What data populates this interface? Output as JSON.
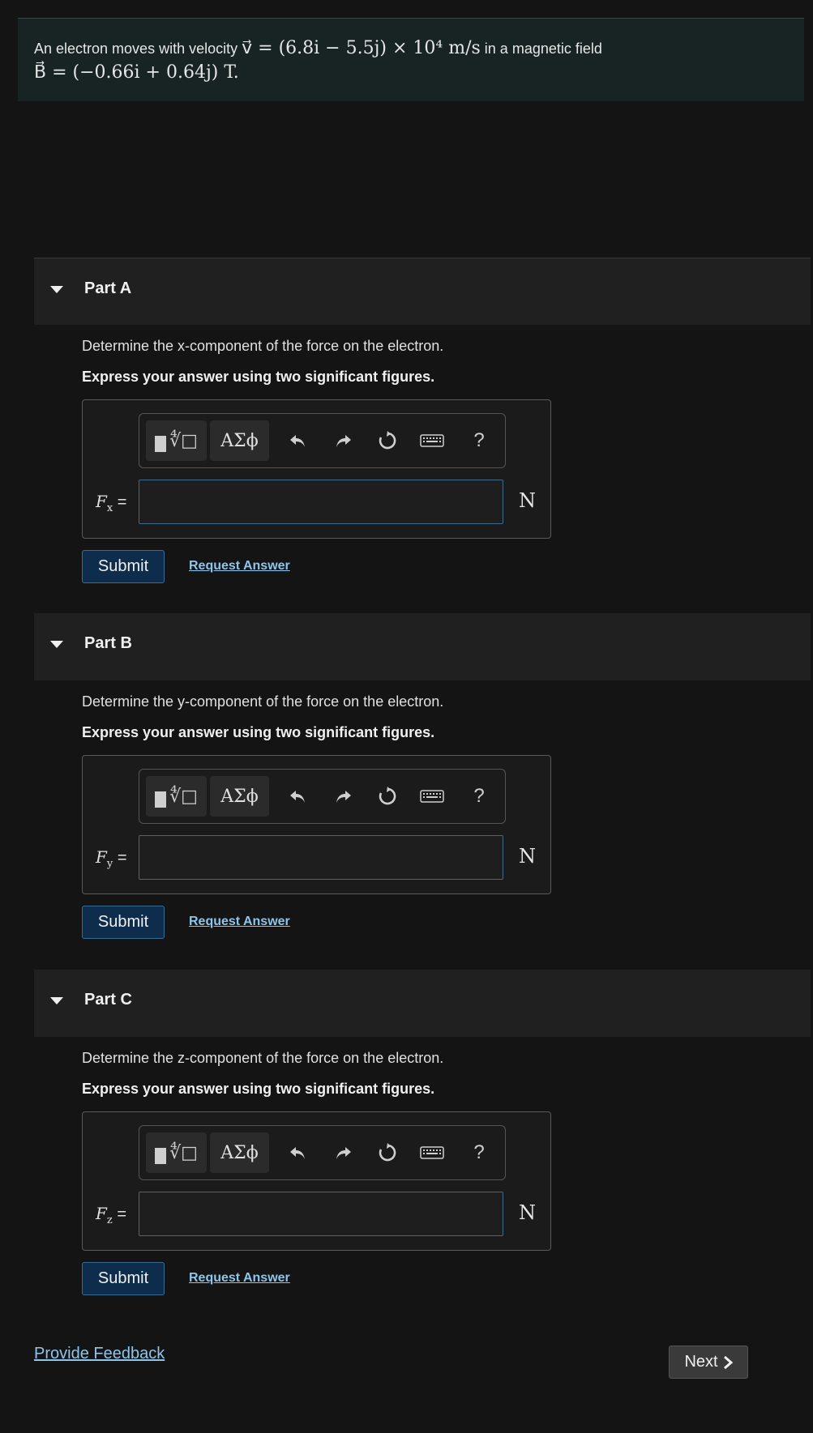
{
  "problem": {
    "prefix": "An electron moves with velocity",
    "velocity_expr": "v⃗ = (6.8i − 5.5j) × 10⁴ m/s",
    "suffix": "in a magnetic field",
    "field_expr": "B⃗ = (−0.66i + 0.64j) T."
  },
  "toolbar": {
    "symbols_label": "ΑΣϕ",
    "help_label": "?"
  },
  "parts": [
    {
      "title": "Part A",
      "prompt": "Determine the x-component of the force on the electron.",
      "instruction": "Express your answer using two significant figures.",
      "var": "F",
      "sub": "x",
      "equals": "=",
      "unit": "N",
      "input_value": "",
      "submit_label": "Submit",
      "request_label": "Request Answer"
    },
    {
      "title": "Part B",
      "prompt": "Determine the y-component of the force on the electron.",
      "instruction": "Express your answer using two significant figures.",
      "var": "F",
      "sub": "y",
      "equals": "=",
      "unit": "N",
      "input_value": "",
      "submit_label": "Submit",
      "request_label": "Request Answer"
    },
    {
      "title": "Part C",
      "prompt": "Determine the z-component of the force on the electron.",
      "instruction": "Express your answer using two significant figures.",
      "var": "F",
      "sub": "z",
      "equals": "=",
      "unit": "N",
      "input_value": "",
      "submit_label": "Submit",
      "request_label": "Request Answer"
    }
  ],
  "footer": {
    "feedback_label": "Provide Feedback",
    "next_label": "Next"
  },
  "icons": {
    "caret": "caret-down-icon",
    "templates": "templates-icon",
    "undo": "undo-icon",
    "redo": "redo-icon",
    "reset": "reset-icon",
    "keyboard": "keyboard-icon",
    "help": "help-icon",
    "next": "chevron-right-icon"
  },
  "colors": {
    "background": "#141414",
    "problem_bg": "#182424",
    "part_header_bg": "#202020",
    "link": "#8ec5ea",
    "submit_bg": "#0e2c4c",
    "input_border": "#3d6b8a"
  }
}
